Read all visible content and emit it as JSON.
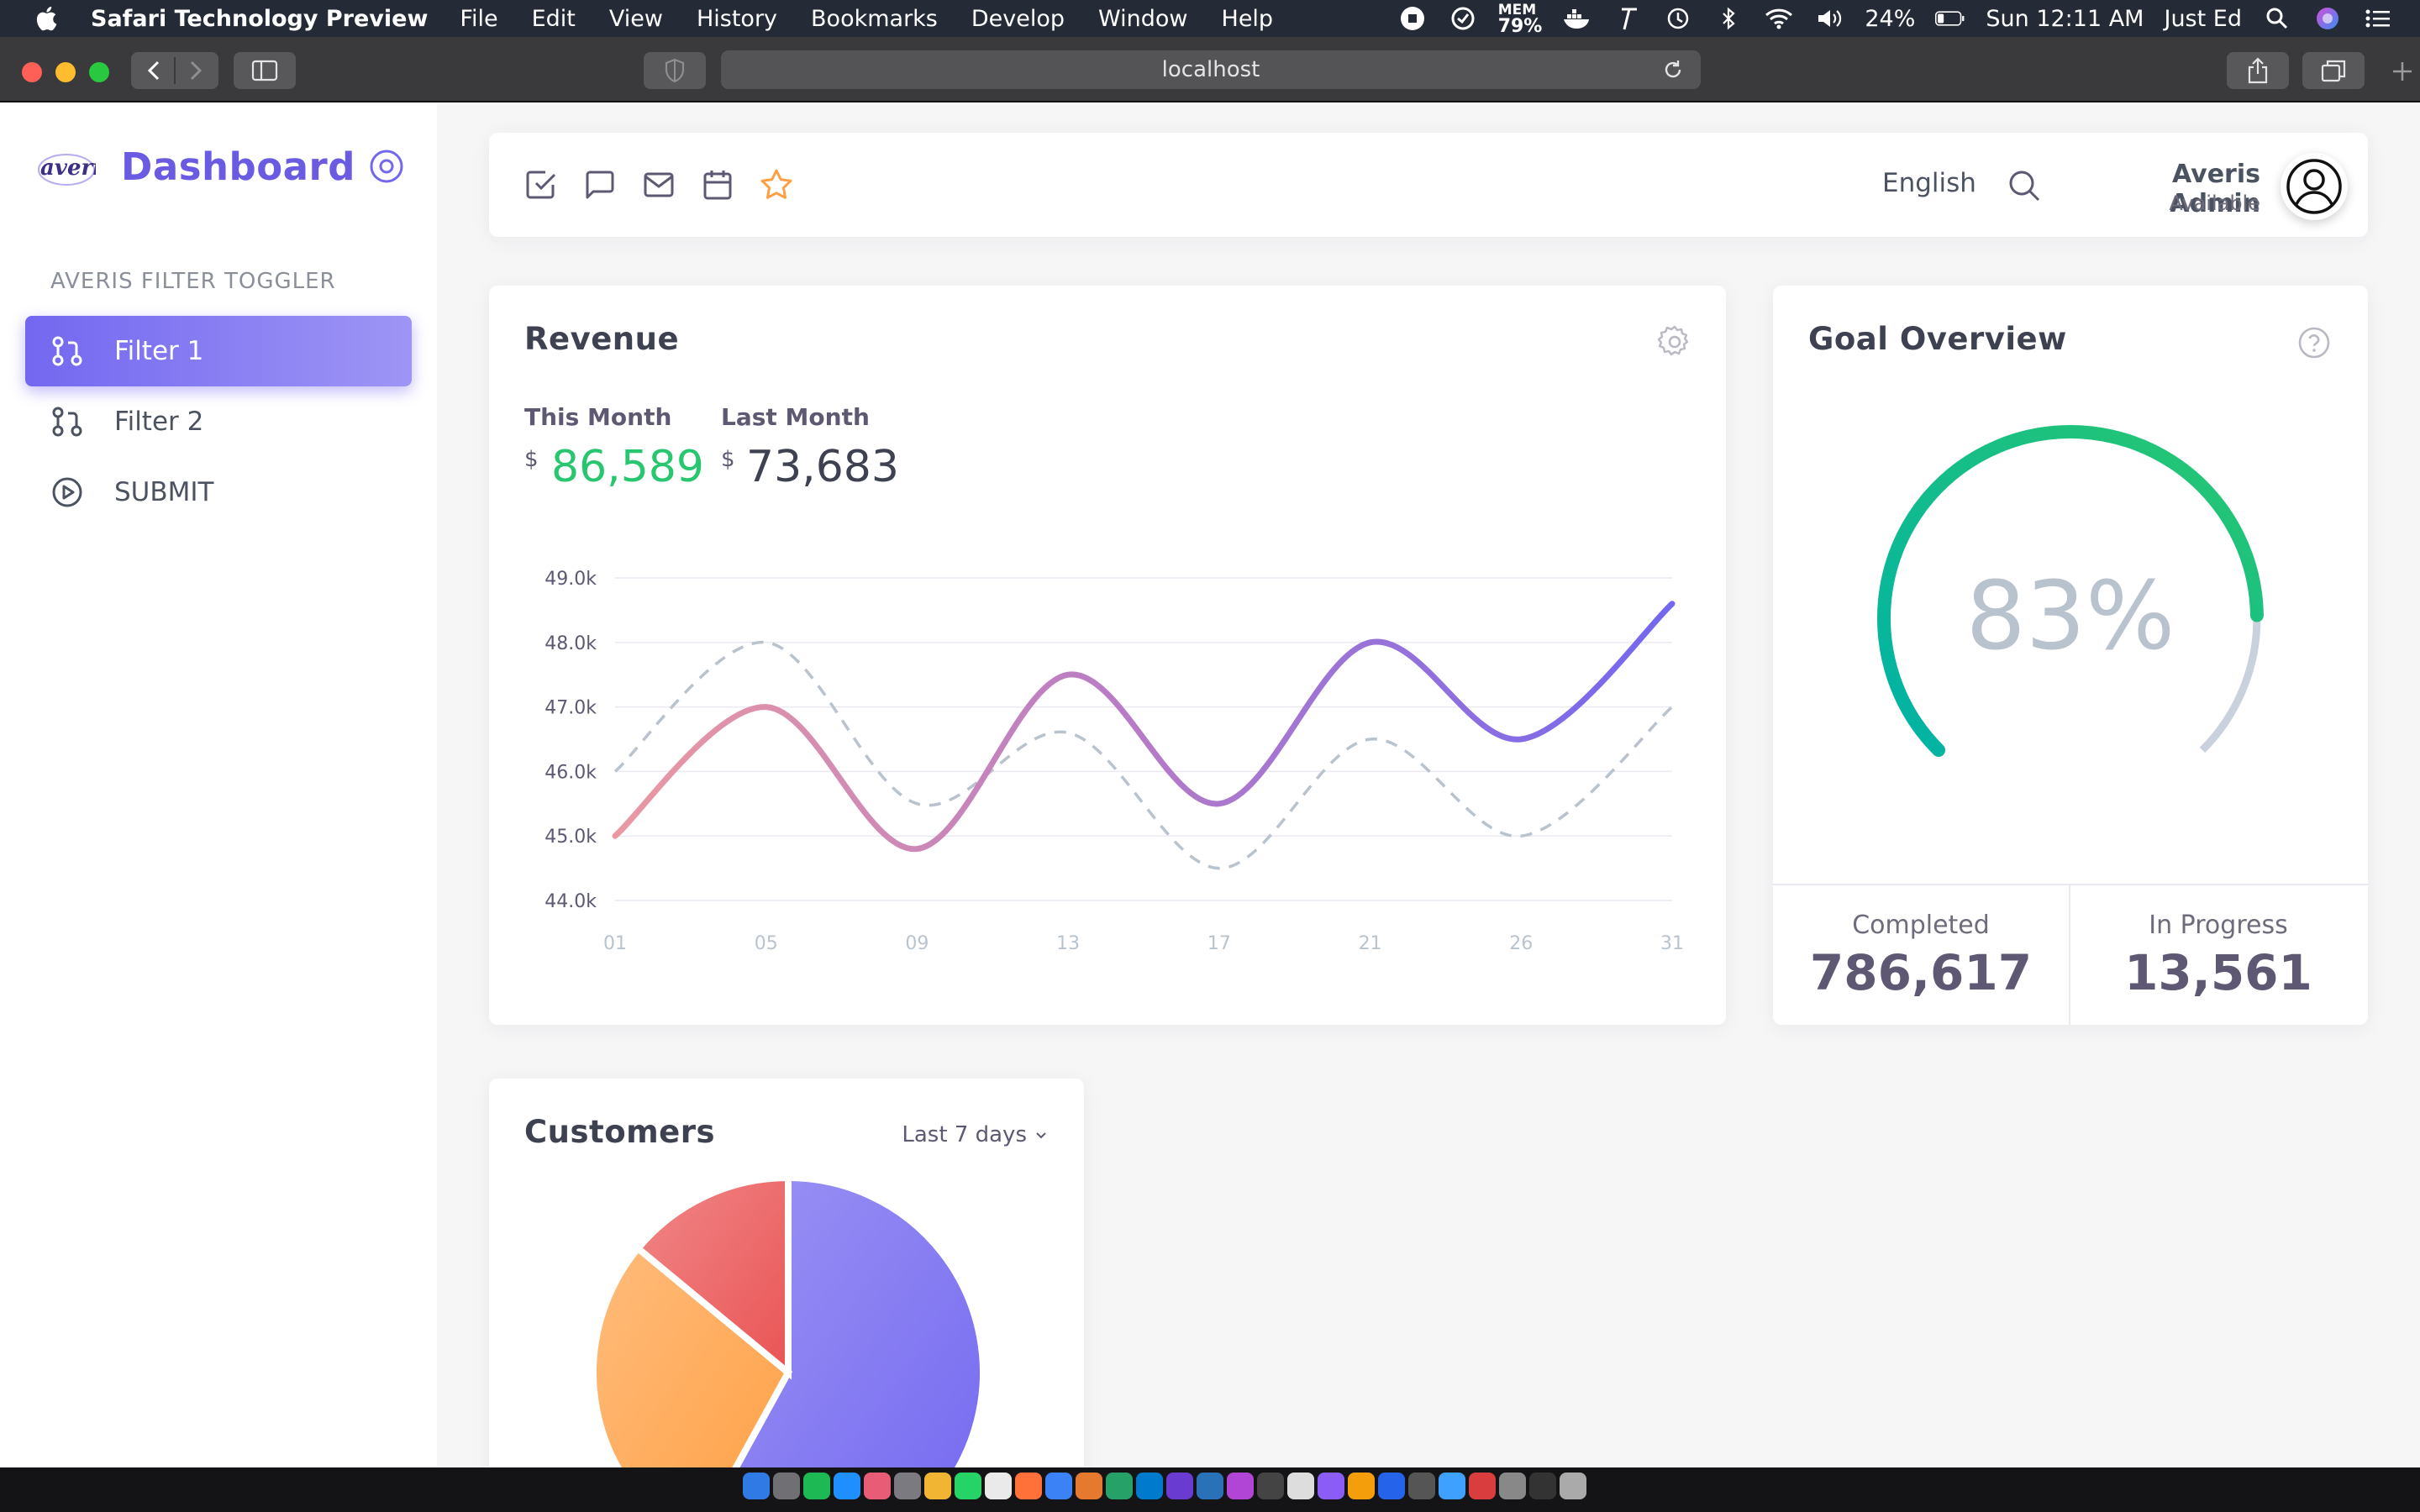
{
  "menubar": {
    "app_name": "Safari Technology Preview",
    "menus": [
      "File",
      "Edit",
      "View",
      "History",
      "Bookmarks",
      "Develop",
      "Window",
      "Help"
    ],
    "mem_label": "MEM",
    "mem_value": "79%",
    "battery": "24%",
    "clock": "Sun 12:11 AM",
    "user": "Just Ed"
  },
  "browser": {
    "url": "localhost"
  },
  "sidebar": {
    "brand_logo_text": "averis",
    "title": "Dashboard",
    "section_heading": "AVERIS FILTER TOGGLER",
    "items": [
      {
        "label": "Filter 1",
        "icon": "git-pull-request-icon",
        "active": true
      },
      {
        "label": "Filter 2",
        "icon": "git-pull-request-icon",
        "active": false
      },
      {
        "label": "SUBMIT",
        "icon": "play-circle-icon",
        "active": false
      }
    ]
  },
  "topnav": {
    "icons": [
      "check-square-icon",
      "message-square-icon",
      "mail-icon",
      "calendar-icon",
      "star-icon"
    ],
    "language": "English",
    "user_name": "Averis Admin",
    "user_status": "Available"
  },
  "revenue": {
    "title": "Revenue",
    "this_month_label": "This Month",
    "this_month_currency": "$",
    "this_month_value": "86,589",
    "last_month_label": "Last Month",
    "last_month_currency": "$",
    "last_month_value": "73,683"
  },
  "goal": {
    "title": "Goal Overview",
    "percent_label": "83%",
    "completed_label": "Completed",
    "completed_value": "786,617",
    "in_progress_label": "In Progress",
    "in_progress_value": "13,561"
  },
  "customers": {
    "title": "Customers",
    "period": "Last 7 days"
  },
  "colors": {
    "primary": "#7367f0",
    "success": "#28c76f",
    "warning": "#ff9f43",
    "danger": "#ea5455",
    "body_text": "#5e5873"
  },
  "chart_data": [
    {
      "type": "line",
      "x": [
        "01",
        "05",
        "09",
        "13",
        "17",
        "21",
        "26",
        "31"
      ],
      "ylim": [
        44000,
        49000
      ],
      "yticks": [
        "44.0k",
        "45.0k",
        "46.0k",
        "47.0k",
        "48.0k",
        "49.0k"
      ],
      "yticks_values": [
        44000,
        45000,
        46000,
        47000,
        48000,
        49000
      ],
      "series": [
        {
          "values": [
            45000,
            47000,
            44800,
            47500,
            45500,
            48000,
            46500,
            48600
          ],
          "style": "solid",
          "gradient": [
            "#ea98a2",
            "#b57bc7",
            "#7367f0"
          ]
        },
        {
          "values": [
            46000,
            48000,
            45500,
            46600,
            44500,
            46500,
            45000,
            47000
          ],
          "style": "dashed",
          "color": "#b9c3cd"
        }
      ],
      "grid": true
    },
    {
      "type": "radialBar",
      "value": 83,
      "label": "83%",
      "colors": [
        "#00b2a6",
        "#28c76f"
      ],
      "track_color": "#c9d2dc"
    },
    {
      "type": "pie",
      "slices": [
        {
          "value": 58,
          "color": "#7367f0"
        },
        {
          "value": 28,
          "color": "#ff9f43"
        },
        {
          "value": 14,
          "color": "#ea5455"
        }
      ]
    }
  ]
}
